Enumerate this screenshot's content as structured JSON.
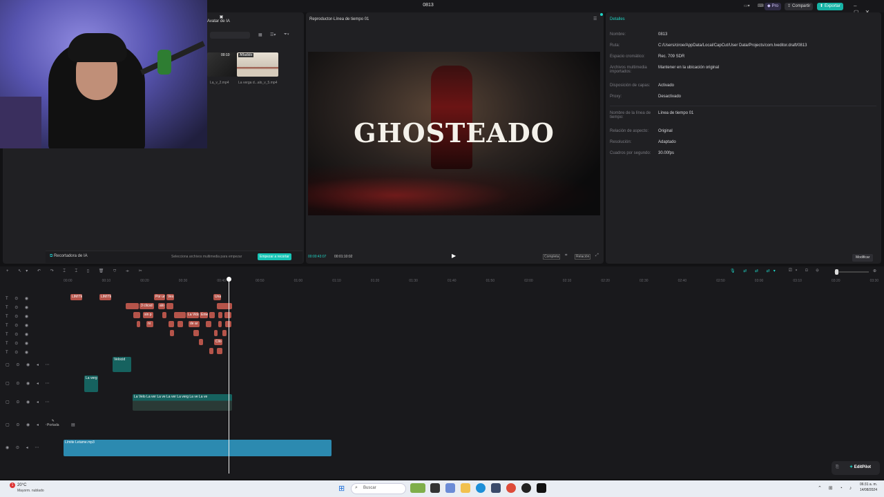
{
  "titlebar": {
    "title": "0813",
    "pro_label": "Pro",
    "share_label": "Compartir",
    "export_label": "Exportar",
    "accent": "#1fd4c4"
  },
  "media": {
    "ai_tab_label": "Avatar de IA",
    "thumb1_duration": "00:10",
    "thumb1_name": "La_v_2.mp4",
    "thumb2_badge": "Añadido",
    "thumb2_name": "La verga d...alo_v_5.mp4",
    "cropper_title": "Recortadora de IA",
    "cropper_hint": "Selecciona archivos multimedia para empezar",
    "cropper_button": "Empezar a recortar"
  },
  "preview": {
    "title": "Reproductor-Línea de tiempo 01",
    "overlay_text": "GHOSTEADO",
    "current_time": "00:00:43:07",
    "total_time": "00:01:10:02",
    "ratio_label": "Completa",
    "quality_label": "Relación"
  },
  "details": {
    "header": "Detalles",
    "rows": [
      {
        "label": "Nombre:",
        "value": "0813"
      },
      {
        "label": "Ruta:",
        "value": "C:/Users/ciroe/AppData/Local/CapCut/User Data/Projects/com.lveditor.draft/0813"
      },
      {
        "label": "Espacio cromático:",
        "value": "Rec. 709 SDR"
      },
      {
        "label": "Archivos multimedia importados:",
        "value": "Mantener en la ubicación original"
      },
      {
        "label": "Disposición de capas:",
        "value": "Activado"
      },
      {
        "label": "Proxy:",
        "value": "Desactivado"
      },
      {
        "label": "Nombre de la línea de tiempo:",
        "value": "Línea de tiempo 01"
      },
      {
        "label": "Relación de aspecto:",
        "value": "Original"
      },
      {
        "label": "Resolución:",
        "value": "Adaptado"
      },
      {
        "label": "Cuadros por segundo:",
        "value": "30.00fps"
      }
    ],
    "modify_button": "Modificar"
  },
  "timeline": {
    "ruler": [
      "00:00",
      "00:10",
      "00:20",
      "00:30",
      "00:40",
      "00:50",
      "01:00",
      "01:10",
      "01:20",
      "01:30",
      "01:40",
      "01:50",
      "02:00",
      "02:10",
      "02:20",
      "02:30",
      "02:40",
      "02:50",
      "03:00",
      "03:10",
      "03:20",
      "03:30"
    ],
    "cover_label": "Portada",
    "audio_clip": "Límite Letame.mp3",
    "text_clips": [
      "LIMITE",
      "LIMITE",
      "Por un",
      "Ves",
      "Una",
      "3 clicsd",
      "alo",
      "sin p",
      "La Vida",
      "Eme",
      "ni",
      "de ar",
      "Cllo"
    ],
    "video_clips": [
      "Velocid",
      "La verg",
      "La",
      "Velo",
      "La ver",
      "La ve",
      "La ver",
      "La verg",
      "La ve",
      "La ve"
    ],
    "editpilot": "EditPilot"
  },
  "taskbar": {
    "weather_temp": "20°C",
    "weather_desc": "Mayorm. nublado",
    "search_placeholder": "Buscar",
    "clock_time": "06:31 a. m.",
    "clock_date": "14/08/2024",
    "notification_count": "1"
  }
}
